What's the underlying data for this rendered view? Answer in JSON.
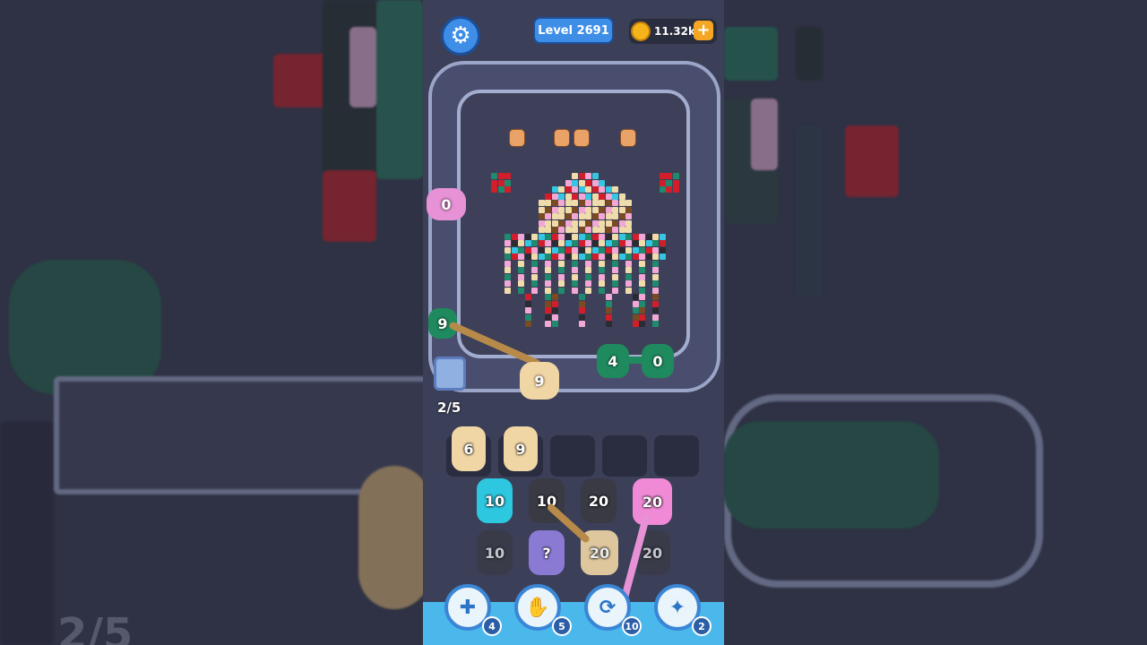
{
  "hud": {
    "level_label": "Level 2691",
    "coins_label": "11.32k",
    "plus_label": "+",
    "gear_glyph": "⚙"
  },
  "progress": {
    "label": "2/5"
  },
  "track_shooters": [
    {
      "value": "0",
      "color": "#e792d6"
    },
    {
      "value": "9",
      "color": "#1f8a5e"
    },
    {
      "value": "9",
      "color": "#f1d6a5"
    },
    {
      "value": "4",
      "color": "#1f8a5e"
    },
    {
      "value": "0",
      "color": "#1f8a5e"
    }
  ],
  "queue_slots": [
    {
      "value": "6",
      "color": "#f1d6a5",
      "filled": true
    },
    {
      "value": "9",
      "color": "#f1d6a5",
      "filled": true
    },
    {
      "value": "",
      "filled": false
    },
    {
      "value": "",
      "filled": false
    },
    {
      "value": "",
      "filled": false
    }
  ],
  "stacks": [
    {
      "value": "10",
      "color": "#2ec7e0"
    },
    {
      "value": "10",
      "color": "#3a3a44"
    },
    {
      "value": "20",
      "color": "#3a3a44"
    },
    {
      "value": "20",
      "color": "#f08ad6"
    },
    {
      "value": "10",
      "color": "#3a3a44"
    },
    {
      "value": "?",
      "color": "#8a7ad4"
    },
    {
      "value": "20",
      "color": "#f1d6a5"
    },
    {
      "value": "20",
      "color": "#3a3a44"
    }
  ],
  "powerups": [
    {
      "name": "add-slot-icon",
      "glyph": "✚",
      "count": "4"
    },
    {
      "name": "hand-icon",
      "glyph": "✋",
      "count": "5"
    },
    {
      "name": "shuffle-icon",
      "glyph": "⟳",
      "count": "10"
    },
    {
      "name": "bunny-icon",
      "glyph": "✦",
      "count": "2"
    }
  ],
  "palette": {
    "red": "#d41d2a",
    "pink": "#f2a7d6",
    "cyan": "#35c6e4",
    "teal": "#1f8a6e",
    "tan": "#f0dcab",
    "brown": "#7a4a22",
    "dark": "#2b2b33",
    "gold": "#e9a368"
  }
}
